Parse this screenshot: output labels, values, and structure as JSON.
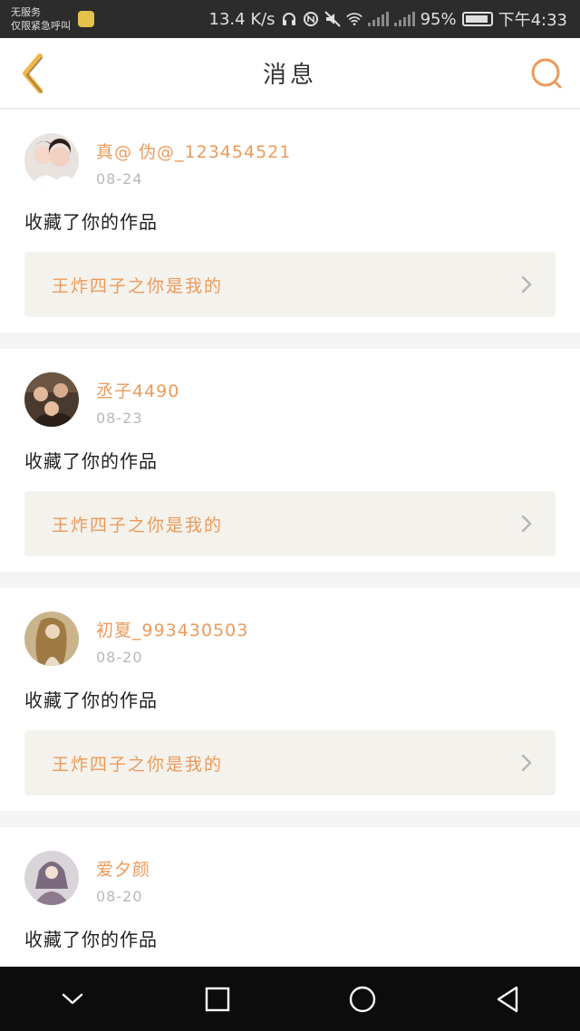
{
  "status_bar": {
    "carrier_line1": "无服务",
    "carrier_line2": "仅限紧急呼叫",
    "speed": "13.4 K/s",
    "battery_percent": "95%",
    "time": "下午4:33",
    "icons": [
      "sim-icon",
      "headphones-icon",
      "nfc-icon",
      "mute-icon",
      "wifi-icon",
      "signal-icon",
      "signal-icon",
      "battery-icon"
    ]
  },
  "header": {
    "title": "消息",
    "back_icon": "chevron-left-icon",
    "search_icon": "search-icon",
    "accent_color": "#ec9a5a"
  },
  "messages": [
    {
      "username": "真@ 伪@_123454521",
      "date": "08-24",
      "action": "收藏了你的作品",
      "work_title": "王炸四子之你是我的"
    },
    {
      "username": "丞子4490",
      "date": "08-23",
      "action": "收藏了你的作品",
      "work_title": "王炸四子之你是我的"
    },
    {
      "username": "初夏_993430503",
      "date": "08-20",
      "action": "收藏了你的作品",
      "work_title": "王炸四子之你是我的"
    },
    {
      "username": "爱夕颜",
      "date": "08-20",
      "action": "收藏了你的作品",
      "work_title": ""
    }
  ],
  "nav_bar": {
    "icons": [
      "collapse-icon",
      "recents-icon",
      "home-icon",
      "back-icon"
    ]
  }
}
